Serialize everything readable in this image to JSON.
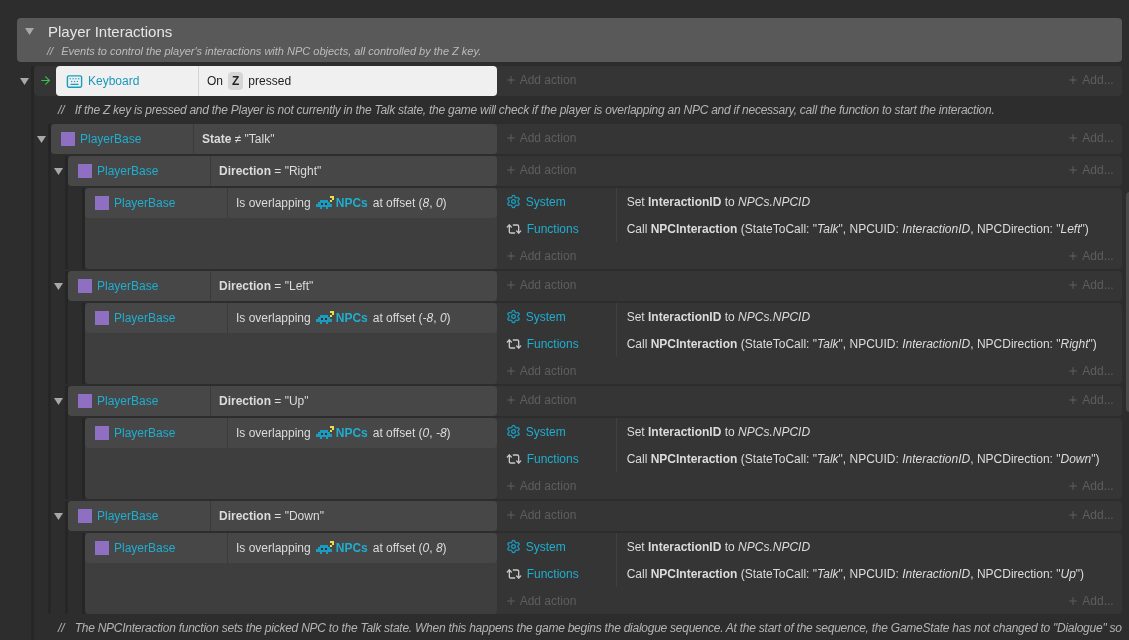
{
  "group": {
    "title": "Player Interactions",
    "expanded": true,
    "comment_mark": "//",
    "comment": "Events to control the player's interactions with NPC objects, all controlled by the Z key."
  },
  "events": [
    {
      "kind": "event",
      "expanded": true,
      "trigger": true,
      "conditions": [
        {
          "object": "Keyboard",
          "kind": "keyboard",
          "selected": true,
          "parts": [
            {
              "kind": "text",
              "text": "On"
            },
            {
              "kind": "key",
              "text": "Z"
            },
            {
              "kind": "text",
              "text": "pressed"
            }
          ]
        }
      ],
      "add_action": "Add action",
      "add_more": "Add...",
      "children": [
        {
          "kind": "comment",
          "mark": "//",
          "text": "If the Z key is pressed and the Player is not currently in the Talk state, the game will check if the player is overlapping an NPC and if necessary, call the function to start the interaction."
        },
        {
          "kind": "event",
          "expanded": true,
          "trigger": false,
          "conditions": [
            {
              "object": "PlayerBase",
              "kind": "sprite",
              "selected": false,
              "parts": [
                {
                  "kind": "text",
                  "text": "**State** ≠ \"Talk\""
                }
              ]
            }
          ],
          "add_action": "Add action",
          "add_more": "Add...",
          "children": [
            {
              "kind": "event",
              "expanded": true,
              "trigger": false,
              "conditions": [
                {
                  "object": "PlayerBase",
                  "kind": "sprite",
                  "selected": false,
                  "parts": [
                    {
                      "kind": "text",
                      "text": "**Direction** = \"Right\""
                    }
                  ]
                }
              ],
              "add_action": "Add action",
              "add_more": "Add...",
              "children": [
                {
                  "kind": "event",
                  "trigger": false,
                  "conditions": [
                    {
                      "object": "PlayerBase",
                      "kind": "sprite",
                      "selected": false,
                      "parts": [
                        {
                          "kind": "text",
                          "text": "Is overlapping"
                        },
                        {
                          "kind": "object",
                          "text": "NPCs"
                        },
                        {
                          "kind": "text",
                          "text": "at offset (*8*, *0*)"
                        }
                      ]
                    }
                  ],
                  "actions": [
                    {
                      "object": "System",
                      "kind": "system",
                      "text": "Set **InteractionID** to *NPCs.NPCID*"
                    },
                    {
                      "object": "Functions",
                      "kind": "functions",
                      "text": "Call **NPCInteraction** (StateToCall: \"*Talk*\", NPCUID: *InteractionID*, NPCDirection: \"*Left*\")"
                    }
                  ],
                  "add_action": "Add action",
                  "add_more": "Add..."
                }
              ]
            },
            {
              "kind": "event",
              "expanded": true,
              "trigger": false,
              "conditions": [
                {
                  "object": "PlayerBase",
                  "kind": "sprite",
                  "selected": false,
                  "parts": [
                    {
                      "kind": "text",
                      "text": "**Direction** = \"Left\""
                    }
                  ]
                }
              ],
              "add_action": "Add action",
              "add_more": "Add...",
              "children": [
                {
                  "kind": "event",
                  "trigger": false,
                  "conditions": [
                    {
                      "object": "PlayerBase",
                      "kind": "sprite",
                      "selected": false,
                      "parts": [
                        {
                          "kind": "text",
                          "text": "Is overlapping"
                        },
                        {
                          "kind": "object",
                          "text": "NPCs"
                        },
                        {
                          "kind": "text",
                          "text": "at offset (*-8*, *0*)"
                        }
                      ]
                    }
                  ],
                  "actions": [
                    {
                      "object": "System",
                      "kind": "system",
                      "text": "Set **InteractionID** to *NPCs.NPCID*"
                    },
                    {
                      "object": "Functions",
                      "kind": "functions",
                      "text": "Call **NPCInteraction** (StateToCall: \"*Talk*\", NPCUID: *InteractionID*, NPCDirection: \"*Right*\")"
                    }
                  ],
                  "add_action": "Add action",
                  "add_more": "Add..."
                }
              ]
            },
            {
              "kind": "event",
              "expanded": true,
              "trigger": false,
              "conditions": [
                {
                  "object": "PlayerBase",
                  "kind": "sprite",
                  "selected": false,
                  "parts": [
                    {
                      "kind": "text",
                      "text": "**Direction** = \"Up\""
                    }
                  ]
                }
              ],
              "add_action": "Add action",
              "add_more": "Add...",
              "children": [
                {
                  "kind": "event",
                  "trigger": false,
                  "conditions": [
                    {
                      "object": "PlayerBase",
                      "kind": "sprite",
                      "selected": false,
                      "parts": [
                        {
                          "kind": "text",
                          "text": "Is overlapping"
                        },
                        {
                          "kind": "object",
                          "text": "NPCs"
                        },
                        {
                          "kind": "text",
                          "text": "at offset (*0*, *-8*)"
                        }
                      ]
                    }
                  ],
                  "actions": [
                    {
                      "object": "System",
                      "kind": "system",
                      "text": "Set **InteractionID** to *NPCs.NPCID*"
                    },
                    {
                      "object": "Functions",
                      "kind": "functions",
                      "text": "Call **NPCInteraction** (StateToCall: \"*Talk*\", NPCUID: *InteractionID*, NPCDirection: \"*Down*\")"
                    }
                  ],
                  "add_action": "Add action",
                  "add_more": "Add..."
                }
              ]
            },
            {
              "kind": "event",
              "expanded": true,
              "trigger": false,
              "conditions": [
                {
                  "object": "PlayerBase",
                  "kind": "sprite",
                  "selected": false,
                  "parts": [
                    {
                      "kind": "text",
                      "text": "**Direction** = \"Down\""
                    }
                  ]
                }
              ],
              "add_action": "Add action",
              "add_more": "Add...",
              "children": [
                {
                  "kind": "event",
                  "trigger": false,
                  "conditions": [
                    {
                      "object": "PlayerBase",
                      "kind": "sprite",
                      "selected": false,
                      "parts": [
                        {
                          "kind": "text",
                          "text": "Is overlapping"
                        },
                        {
                          "kind": "object",
                          "text": "NPCs"
                        },
                        {
                          "kind": "text",
                          "text": "at offset (*0*, *8*)"
                        }
                      ]
                    }
                  ],
                  "actions": [
                    {
                      "object": "System",
                      "kind": "system",
                      "text": "Set **InteractionID** to *NPCs.NPCID*"
                    },
                    {
                      "object": "Functions",
                      "kind": "functions",
                      "text": "Call **NPCInteraction** (StateToCall: \"*Talk*\", NPCUID: *InteractionID*, NPCDirection: \"*Up*\")"
                    }
                  ],
                  "add_action": "Add action",
                  "add_more": "Add..."
                }
              ]
            }
          ]
        },
        {
          "kind": "comment",
          "mark": "//",
          "text": "The NPCInteraction function sets the picked NPC to the Talk state. When this happens the game begins the dialogue sequence. At the start of the sequence, the GameState has not changed to \"Dialogue\" so"
        }
      ]
    }
  ]
}
